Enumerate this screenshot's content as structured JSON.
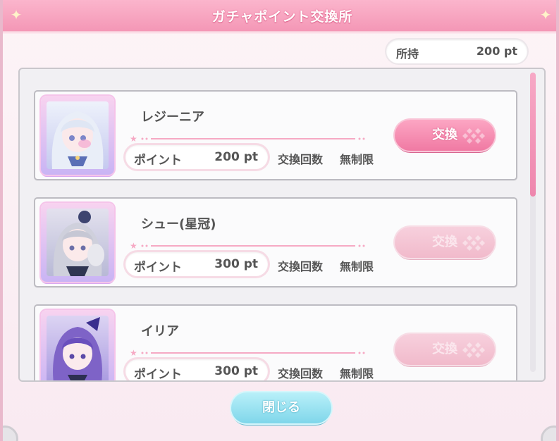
{
  "header": {
    "title": "ガチャポイント交換所"
  },
  "owned": {
    "label": "所持",
    "value": "200 pt"
  },
  "items": [
    {
      "name": "レジーニア",
      "cost_label": "ポイント",
      "cost": "200 pt",
      "limit_label": "交換回数",
      "limit_value": "無制限",
      "button_label": "交換",
      "enabled": true
    },
    {
      "name": "シュー(星冠)",
      "cost_label": "ポイント",
      "cost": "300 pt",
      "limit_label": "交換回数",
      "limit_value": "無制限",
      "button_label": "交換",
      "enabled": false
    },
    {
      "name": "イリア",
      "cost_label": "ポイント",
      "cost": "300 pt",
      "limit_label": "交換回数",
      "limit_value": "無制限",
      "button_label": "交換",
      "enabled": false
    }
  ],
  "footer": {
    "close_label": "閉じる"
  },
  "colors": {
    "accent_pink": "#f07aa3",
    "close_cyan": "#7fd6ea",
    "text": "#555555"
  }
}
